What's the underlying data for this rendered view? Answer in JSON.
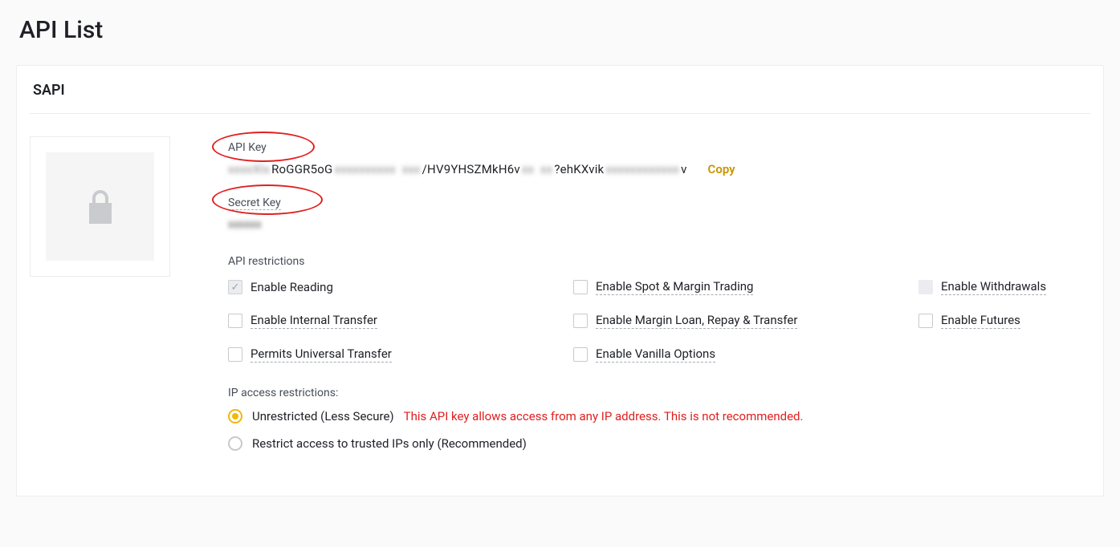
{
  "page_title": "API List",
  "api_name": "SAPI",
  "api_key": {
    "label": "API Key",
    "value_parts": {
      "p1": "xxxxXIx",
      "p2": "RoGGR5oG",
      "p3": "xxxxxxxxxx",
      "p4": "xxx",
      "p5": "/HV9YHSZMkH6v",
      "p6": "xx",
      "p7": "xx",
      "p8": "?ehKXvik",
      "p9": "xxxxxxxxxxxx",
      "p10": "v"
    },
    "copy_label": "Copy"
  },
  "secret_key": {
    "label": "Secret Key",
    "value": "xxxxxx"
  },
  "restrictions": {
    "section_label": "API restrictions",
    "items": [
      {
        "label": "Enable Reading",
        "checked": true,
        "disabled": true,
        "underline": false
      },
      {
        "label": "Enable Spot & Margin Trading",
        "checked": false,
        "disabled": false,
        "underline": true
      },
      {
        "label": "Enable Withdrawals",
        "checked": false,
        "disabled": true,
        "underline": true
      },
      {
        "label": "Enable Internal Transfer",
        "checked": false,
        "disabled": false,
        "underline": true
      },
      {
        "label": "Enable Margin Loan, Repay & Transfer",
        "checked": false,
        "disabled": false,
        "underline": true
      },
      {
        "label": "Enable Futures",
        "checked": false,
        "disabled": false,
        "underline": true
      },
      {
        "label": "Permits Universal Transfer",
        "checked": false,
        "disabled": false,
        "underline": true
      },
      {
        "label": "Enable Vanilla Options",
        "checked": false,
        "disabled": false,
        "underline": true
      }
    ]
  },
  "ip_access": {
    "title": "IP access restrictions:",
    "options": [
      {
        "label": "Unrestricted (Less Secure)",
        "selected": true,
        "warning": "This API key allows access from any IP address. This is not recommended."
      },
      {
        "label": "Restrict access to trusted IPs only (Recommended)",
        "selected": false,
        "warning": ""
      }
    ]
  }
}
